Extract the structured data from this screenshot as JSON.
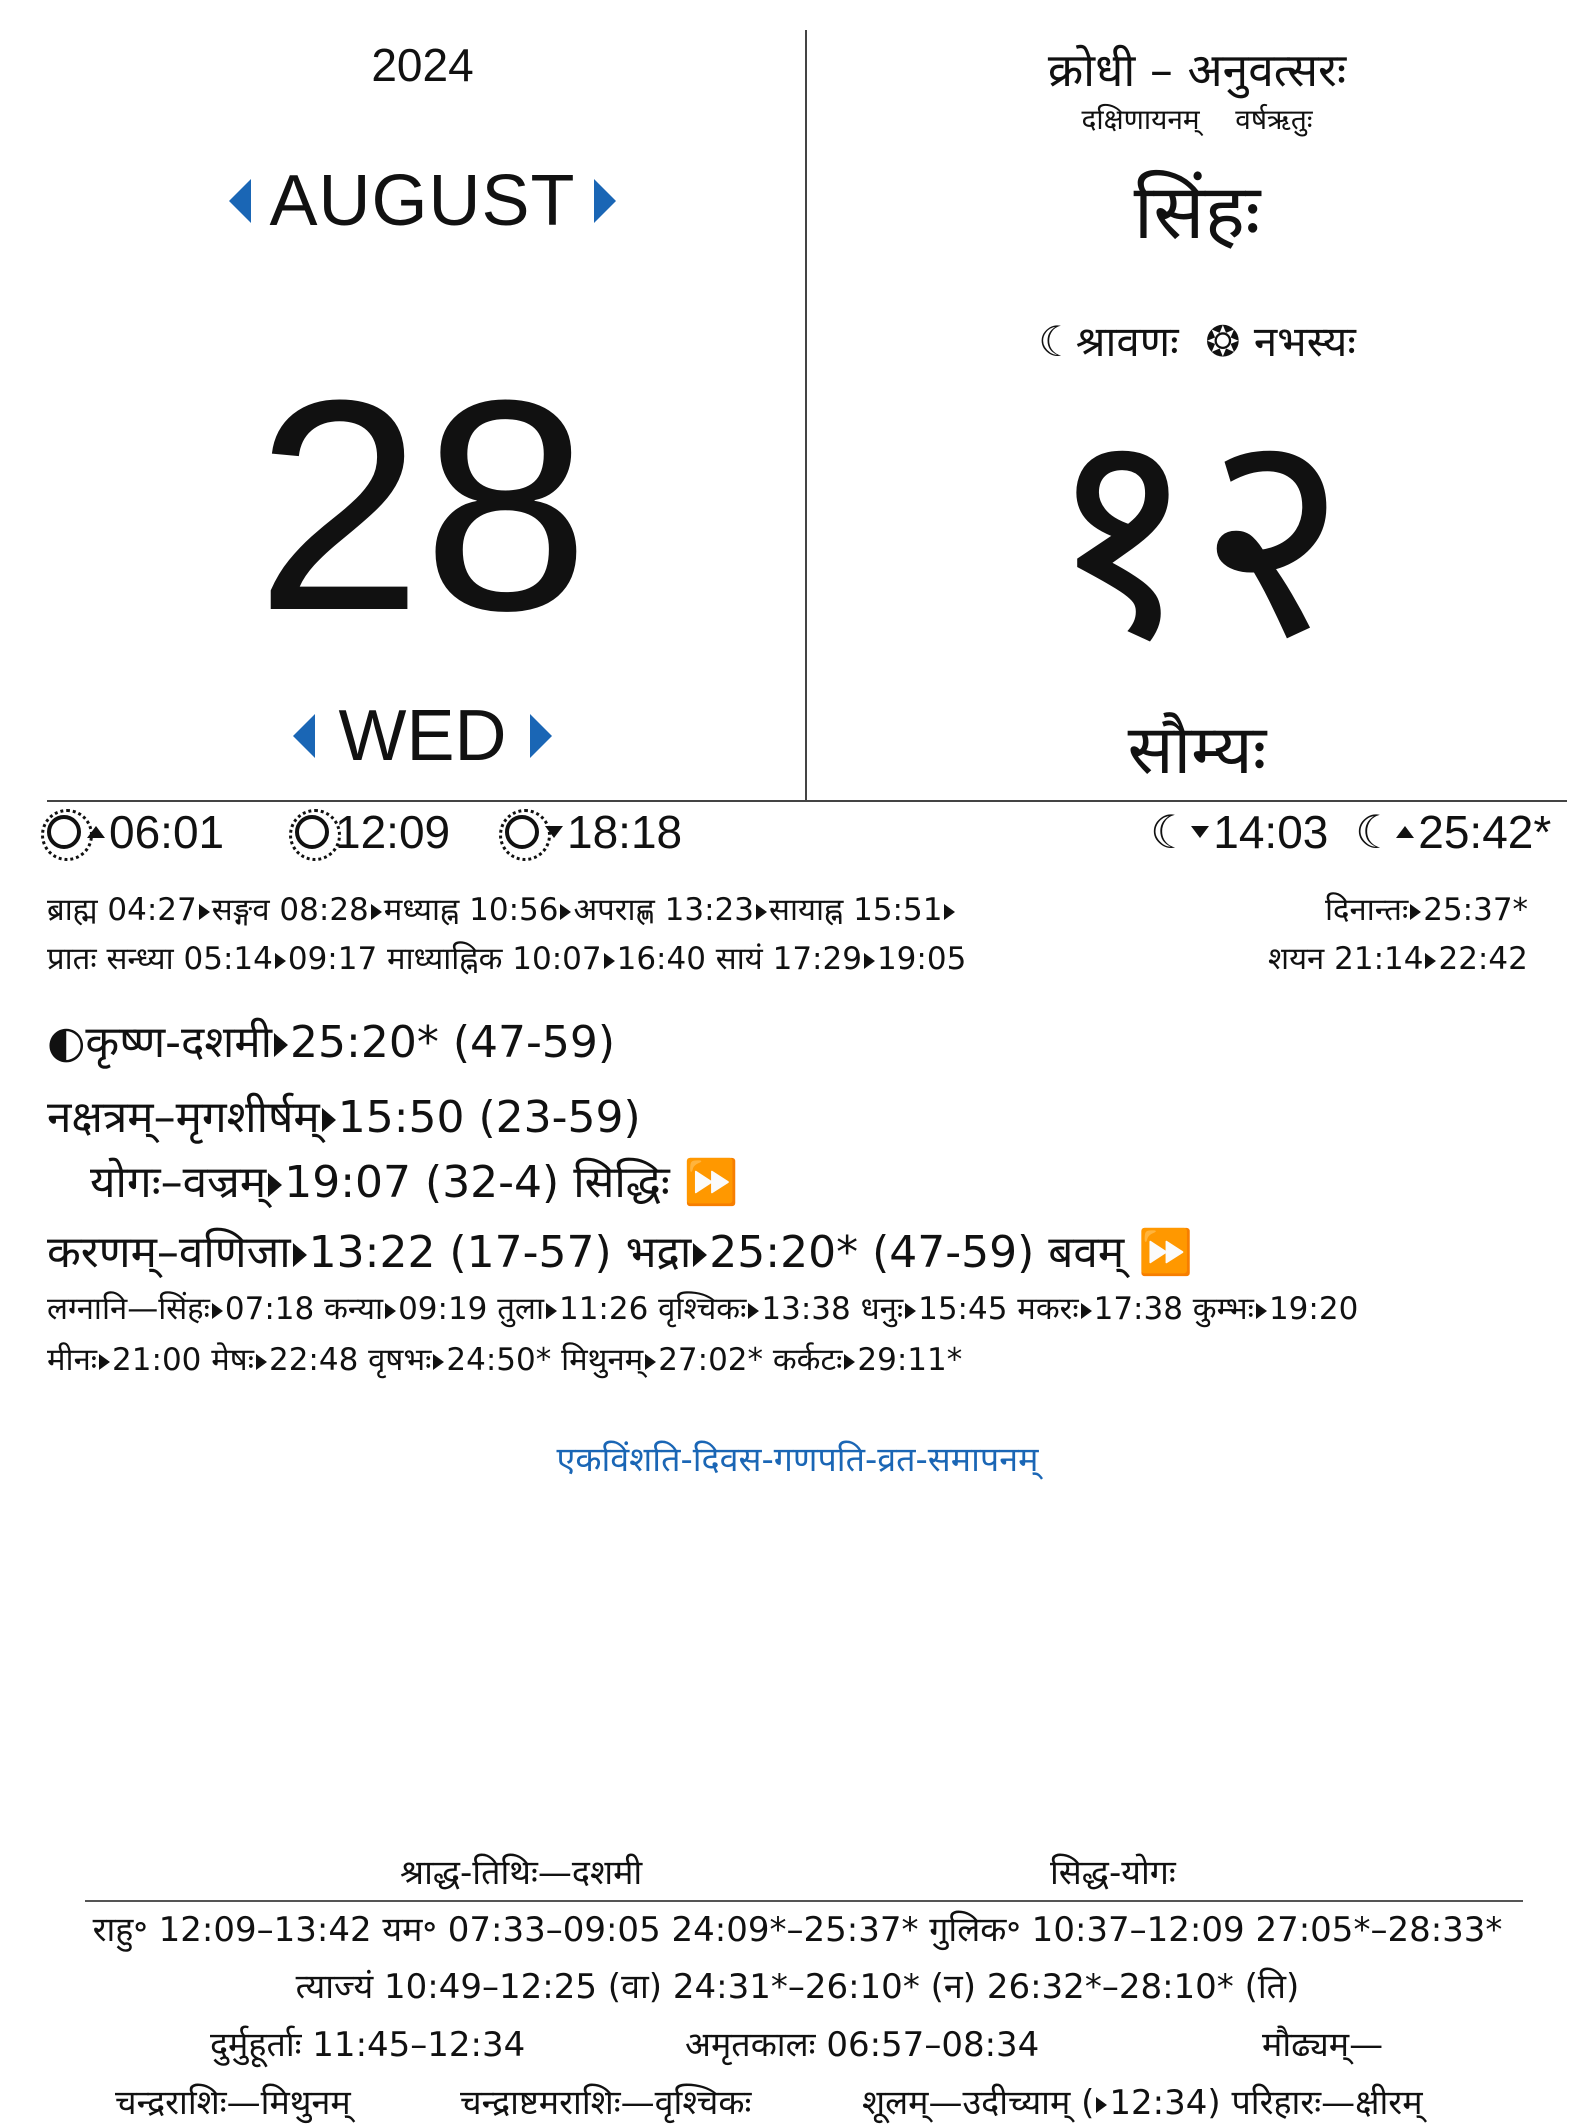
{
  "header_left": {
    "year": "2024",
    "month": "AUGUST",
    "day": "28",
    "weekday": "WED"
  },
  "header_right": {
    "samvatsara": "क्रोधी – अनुवत्सरः",
    "ayana": "दक्षिणायनम्",
    "ritu": "वर्षऋतुः",
    "rashi": "सिंहः",
    "chandra_masa": "श्रावणः",
    "saura_masa": "नभस्यः",
    "lunar_day": "१२",
    "vara": "सौम्यः"
  },
  "sun_moon": {
    "sunrise": "06:01",
    "noon": "12:09",
    "sunset": "18:18",
    "moonset": "14:03",
    "moonrise": "25:42*"
  },
  "kala": {
    "row1": [
      "ब्राह्म 04:27",
      "सङ्गव 08:28",
      "मध्याह्न 10:56",
      "अपराह्ण 13:23",
      "सायाह्न 15:51"
    ],
    "dinanta": "दिनान्तः",
    "dinanta_time": "25:37*",
    "row2_prefix": "प्रातः सन्ध्या 05:14",
    "row2_b": "09:17 माध्याह्निक 10:07",
    "row2_c": "16:40 सायं 17:29",
    "row2_d": "19:05",
    "shayana": "शयन 21:14",
    "shayana_end": "22:42"
  },
  "panchanga": {
    "tithi": "कृष्ण-दशमी",
    "tithi_end": "25:20* (47-59)",
    "nakshatra": "नक्षत्रम्–मृगशीर्षम्",
    "nakshatra_end": "15:50 (23-59)",
    "yoga": "योगः–वज्रम्",
    "yoga_end": "19:07 (32-4)  सिद्धिः",
    "karana": "करणम्–वणिजा",
    "karana_end": "13:22 (17-57)  भद्रा",
    "bhadra_end": "25:20* (47-59)  बवम्"
  },
  "lagnani": {
    "row1": [
      "लग्नानि—सिंहः",
      "07:18  कन्या",
      "09:19  तुला",
      "11:26  वृश्चिकः",
      "13:38  धनुः",
      "15:45  मकरः",
      "17:38  कुम्भः",
      "19:20"
    ],
    "row2": [
      "मीनः",
      "21:00  मेषः",
      "22:48  वृषभः",
      "24:50*  मिथुनम्",
      "27:02*  कर्कटः",
      "29:11*"
    ]
  },
  "festival": "एकविंशति-दिवस-गणपति-व्रत-समापनम्",
  "bottom": {
    "shraddha": "श्राद्ध-तिथिः—दशमी",
    "siddha_yoga": "सिद्ध-योगः",
    "rahu_yama_gulika": "राहु॰ 12:09–13:42   यम॰ 07:33–09:05  24:09*–25:37*   गुलिक॰ 10:37–12:09  27:05*–28:33*",
    "tyajyam": "त्याज्यं 10:49–12:25 (वा) 24:31*–26:10* (न) 26:32*–28:10* (ति)",
    "durmuhurta": "दुर्मुहूर्ताः 11:45–12:34",
    "amritakala": "अमृतकालः 06:57–08:34",
    "maudhyam": "मौढ्यम्—",
    "chandra_rashi": "चन्द्रराशिः—मिथुनम्",
    "chandrashtama": "चन्द्राष्टमराशिः—वृश्चिकः",
    "shula": "शूलम्—उदीच्याम् (",
    "shula_time": "12:34) परिहारः—क्षीरम्"
  },
  "colors": {
    "accent": "#1a66b5",
    "text": "#111111"
  }
}
